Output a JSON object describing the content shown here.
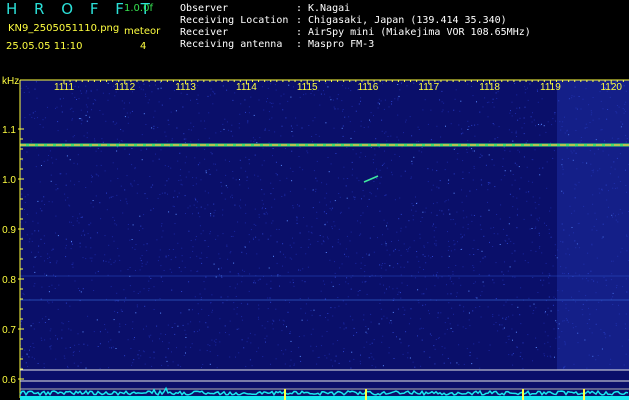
{
  "header": {
    "logo": "H R O F F T",
    "version": "1.0.0f",
    "filename": "KN9_2505051110.png",
    "mode": "meteor",
    "datetime": "25.05.05 11:10",
    "number": "4",
    "meta": [
      {
        "label": "Observer",
        "value": "K.Nagai"
      },
      {
        "label": "Receiving Location",
        "value": "Chigasaki, Japan (139.414 35.340)"
      },
      {
        "label": "Receiver",
        "value": "AirSpy mini (Miakejima VOR 108.65MHz)"
      },
      {
        "label": "Receiving antenna",
        "value": "Maspro FM-3"
      }
    ]
  },
  "spectrogram": {
    "y_unit": "kHz",
    "y_ticks": [
      "1.1",
      "1.0",
      "0.9",
      "0.8",
      "0.7",
      "0.6"
    ],
    "x_ticks": [
      "1111",
      "1112",
      "1113",
      "1114",
      "1115",
      "1116",
      "1117",
      "1118",
      "1119",
      "1120"
    ],
    "colors": {
      "background": "#0a0f6a",
      "signal": "#ffb040",
      "axis": "#ffff40",
      "spectrum": "#18e8f0"
    }
  }
}
